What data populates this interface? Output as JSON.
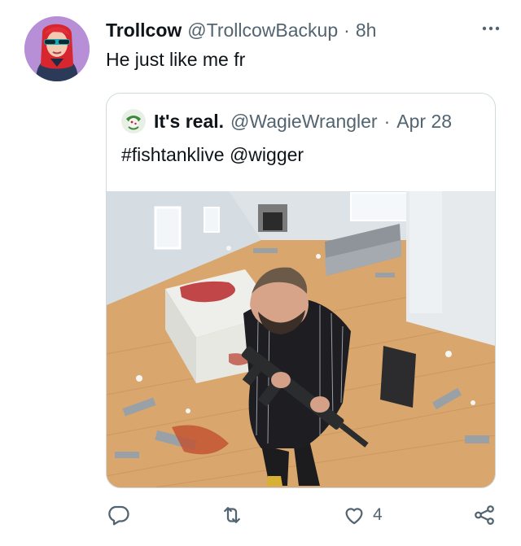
{
  "post": {
    "display_name": "Trollcow",
    "handle": "@TrollcowBackup",
    "separator": "·",
    "time": "8h",
    "text": "He just like me fr"
  },
  "quoted": {
    "display_name": "It's real.",
    "handle": "@WagieWrangler",
    "separator": "·",
    "date": "Apr 28",
    "text": "#fishtanklive @wigger"
  },
  "actions": {
    "reply_count": "",
    "repost_count": "",
    "like_count": "4"
  },
  "icons": {
    "more": "more-dots-icon",
    "reply": "reply-icon",
    "repost": "repost-icon",
    "like": "heart-icon",
    "share": "share-icon"
  },
  "colors": {
    "text": "#0f1419",
    "muted": "#536471",
    "border": "#cfd9de",
    "avatar_bg": "#b68fd6"
  }
}
